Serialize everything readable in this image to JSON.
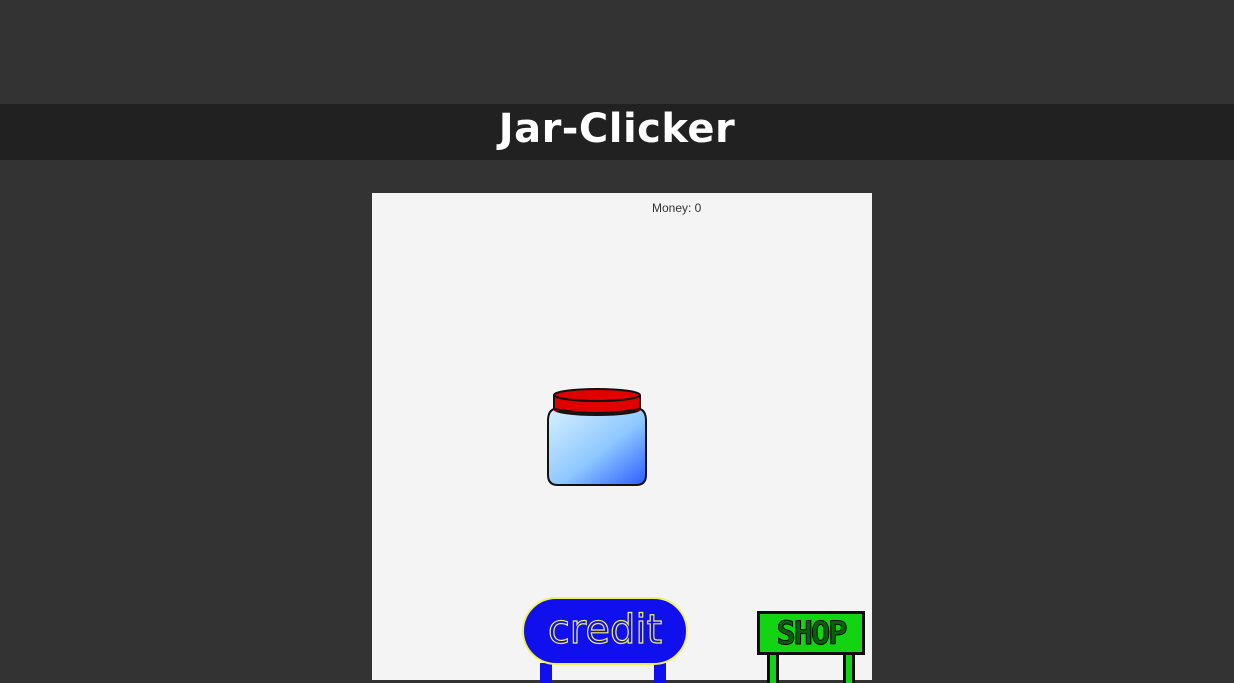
{
  "header": {
    "title": "Jar-Clicker"
  },
  "game": {
    "money_label": "Money:",
    "money_value": "0",
    "money_text": "Money: 0"
  },
  "buttons": {
    "credit_label": "credit",
    "shop_label": "SHOP"
  },
  "colors": {
    "page_background": "#333333",
    "title_bar": "#212121",
    "game_panel": "#f4f4f4",
    "jar_lid": "#e00000",
    "jar_glass_light": "#c9e8ff",
    "jar_glass_dark": "#2b5cff",
    "credit_sign": "#1010ee",
    "credit_outline": "#f1f15a",
    "shop_sign": "#13d413"
  },
  "icons": {
    "jar": "jar-icon",
    "credit": "credit-sign-icon",
    "shop": "shop-sign-icon"
  }
}
